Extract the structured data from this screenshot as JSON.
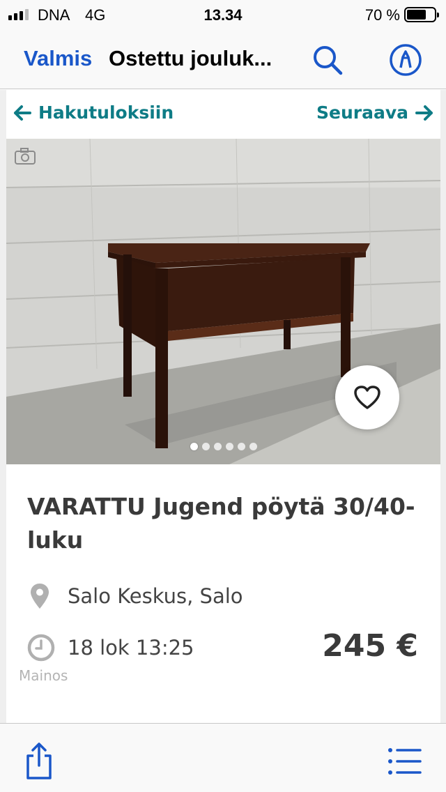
{
  "status_bar": {
    "carrier": "DNA",
    "network": "4G",
    "time": "13.34",
    "battery": "70 %",
    "battery_level": 0.7,
    "signal_bars": 3
  },
  "nav_bar": {
    "done_label": "Valmis",
    "title": "Ostettu jouluk..."
  },
  "listing_nav": {
    "back_label": "Hakutuloksiin",
    "next_label": "Seuraava"
  },
  "listing": {
    "title": "VARATTU Jugend pöytä 30/40-luku",
    "location": "Salo Keskus, Salo",
    "date": "18 lok 13:25",
    "price": "245 €",
    "ad_label": "Mainos",
    "image_count": 6,
    "active_image": 0
  },
  "colors": {
    "ios_blue": "#1a57c9",
    "link_teal": "#0e7c86",
    "text_dark": "#3a3a3a"
  },
  "icons": {
    "nav": [
      "search-icon",
      "markup-icon"
    ],
    "listing": [
      "arrow-left-icon",
      "arrow-right-icon",
      "camera-icon",
      "heart-icon",
      "location-pin-icon",
      "clock-icon"
    ],
    "toolbar": [
      "share-icon",
      "list-icon"
    ]
  }
}
